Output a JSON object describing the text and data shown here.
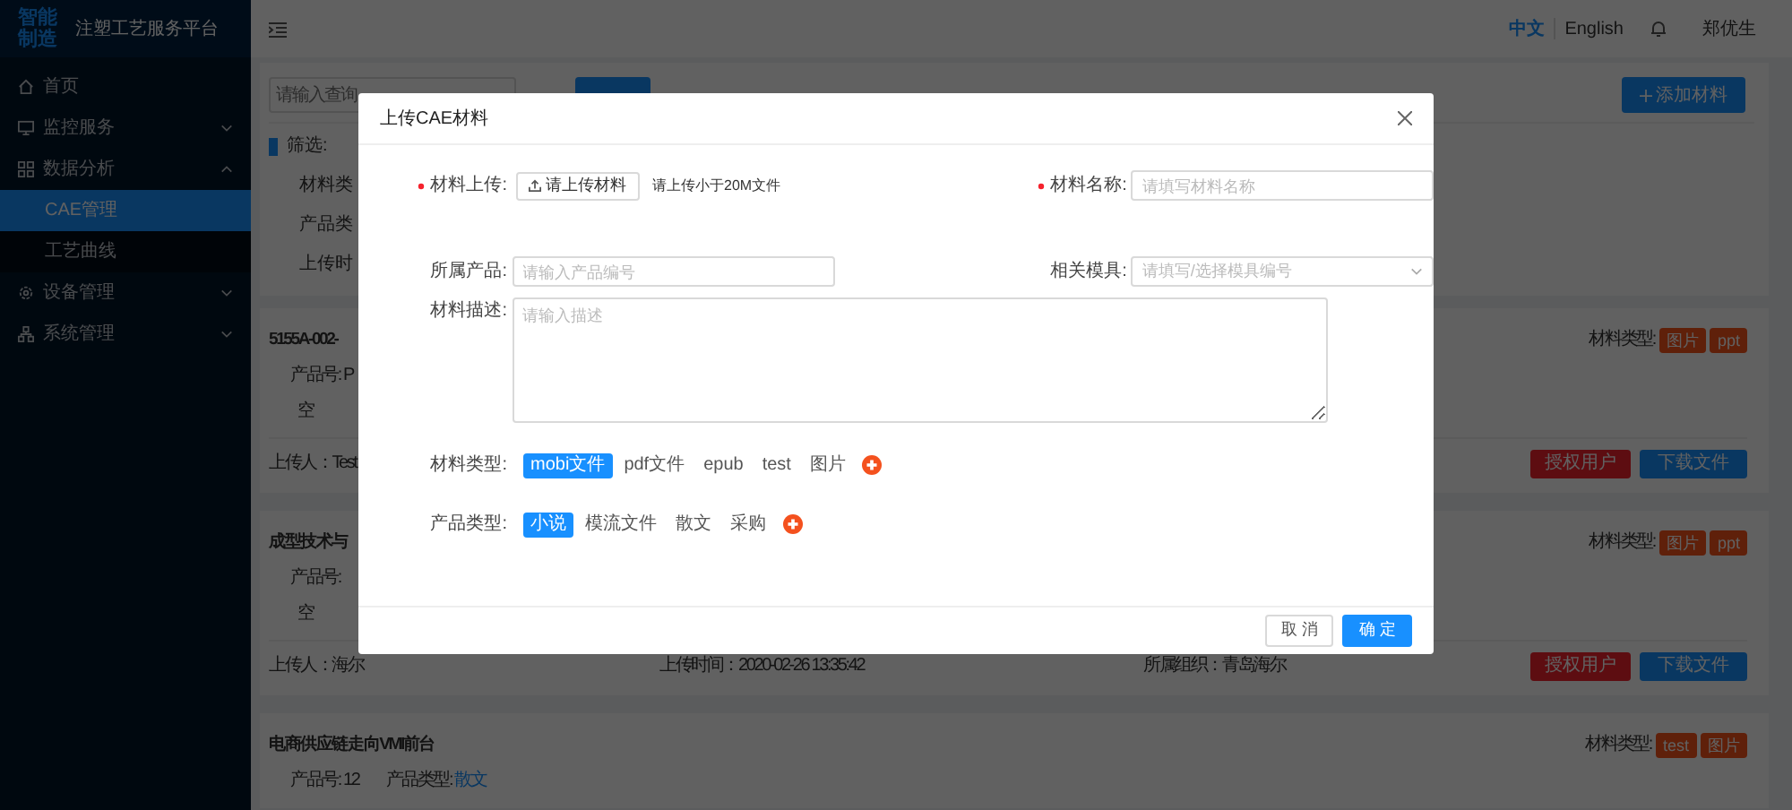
{
  "sidebar": {
    "logo": [
      "智能",
      "制造"
    ],
    "title": "注塑工艺服务平台",
    "items": [
      {
        "label": "首页",
        "kind": "link"
      },
      {
        "label": "监控服务",
        "kind": "submenu",
        "expanded": false
      },
      {
        "label": "数据分析",
        "kind": "submenu",
        "expanded": true,
        "children": [
          {
            "label": "CAE管理",
            "selected": true
          },
          {
            "label": "工艺曲线",
            "selected": false
          }
        ]
      },
      {
        "label": "设备管理",
        "kind": "submenu",
        "expanded": false
      },
      {
        "label": "系统管理",
        "kind": "submenu",
        "expanded": false
      }
    ]
  },
  "header": {
    "languages": [
      {
        "label": "中文",
        "selected": true
      },
      {
        "label": "English",
        "selected": false
      }
    ],
    "user": "郑优生"
  },
  "toolbar": {
    "search_placeholder": "请输入查询",
    "add_button": "添加材料"
  },
  "filter": {
    "label": "筛选:",
    "rows": [
      "材料类",
      "产品类",
      "上传时"
    ]
  },
  "cards": [
    {
      "title": "5155A-002-",
      "product_no": "产品号: P",
      "description": "空",
      "uploader": "上传人：Test",
      "material_label": "材料类型:",
      "material_types": [
        "图片",
        "ppt"
      ],
      "actions": [
        "授权用户",
        "下载文件"
      ]
    },
    {
      "title": "成型技术与",
      "product_no": "产品号:",
      "description": "空",
      "uploader": "上传人：海尔",
      "upload_time": "上传时间：2020-02-26 13:35:42",
      "organization": "所属组织：青岛海尔",
      "material_label": "材料类型:",
      "material_types": [
        "图片",
        "ppt"
      ],
      "actions": [
        "授权用户",
        "下载文件"
      ]
    },
    {
      "title": "电商供应链走向VMI前台",
      "product_no": "产品号: 12",
      "product_type_label": "产品类型:",
      "product_type": "散文",
      "material_label": "材料类型:",
      "material_types": [
        "test",
        "图片"
      ]
    }
  ],
  "modal": {
    "title": "上传CAE材料",
    "upload": {
      "label": "材料上传:",
      "required": true,
      "button": "请上传材料",
      "hint": "请上传小于20M文件"
    },
    "name": {
      "label": "材料名称:",
      "required": true,
      "placeholder": "请填写材料名称"
    },
    "product": {
      "label": "所属产品:",
      "required": false,
      "placeholder": "请输入产品编号"
    },
    "mold": {
      "label": "相关模具:",
      "required": false,
      "placeholder": "请填写/选择模具编号"
    },
    "description": {
      "label": "材料描述:",
      "placeholder": "请输入描述"
    },
    "material_types": {
      "label": "材料类型:",
      "options": [
        {
          "label": "mobi文件",
          "selected": true
        },
        {
          "label": "pdf文件",
          "selected": false
        },
        {
          "label": "epub",
          "selected": false
        },
        {
          "label": "test",
          "selected": false
        },
        {
          "label": "图片",
          "selected": false
        }
      ]
    },
    "product_types": {
      "label": "产品类型:",
      "options": [
        {
          "label": "小说",
          "selected": true
        },
        {
          "label": "模流文件",
          "selected": false
        },
        {
          "label": "散文",
          "selected": false
        },
        {
          "label": "采购",
          "selected": false
        }
      ]
    },
    "buttons": [
      {
        "label": "取 消",
        "kind": "default"
      },
      {
        "label": "确 定",
        "kind": "primary"
      }
    ]
  }
}
